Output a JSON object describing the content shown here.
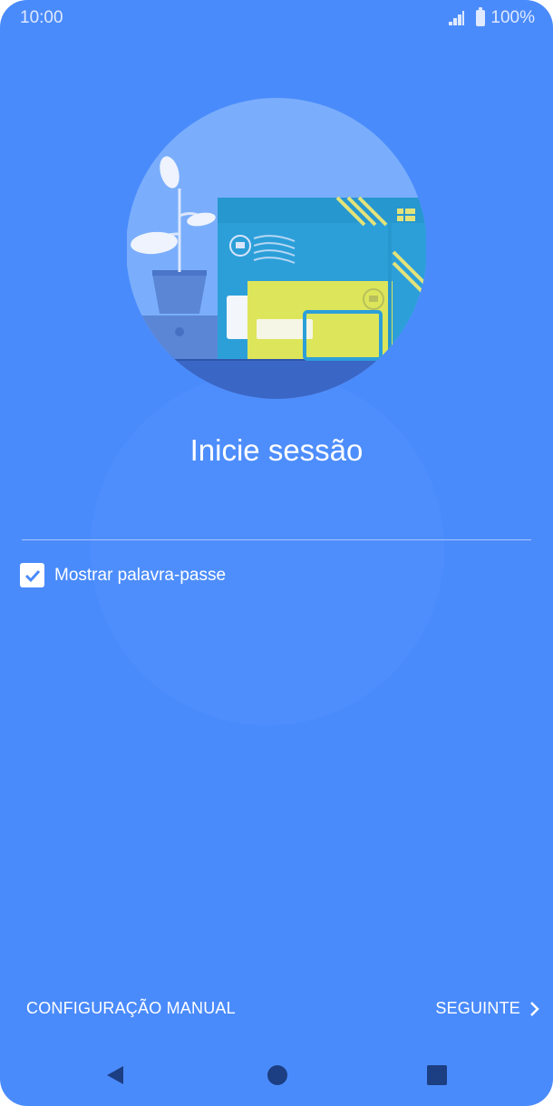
{
  "status_bar": {
    "time": "10:00",
    "battery_text": "100%"
  },
  "page": {
    "title": "Inicie sessão"
  },
  "password_field": {
    "value": ""
  },
  "show_password": {
    "label": "Mostrar palavra-passe",
    "checked": true
  },
  "actions": {
    "manual_label": "CONFIGURAÇÃO MANUAL",
    "next_label": "SEGUINTE"
  },
  "colors": {
    "background": "#4a8bfc",
    "accent": "#4a8bfc",
    "text": "#ffffff"
  },
  "nav": {
    "back": "back-icon",
    "home": "home-icon",
    "recents": "recents-icon"
  }
}
